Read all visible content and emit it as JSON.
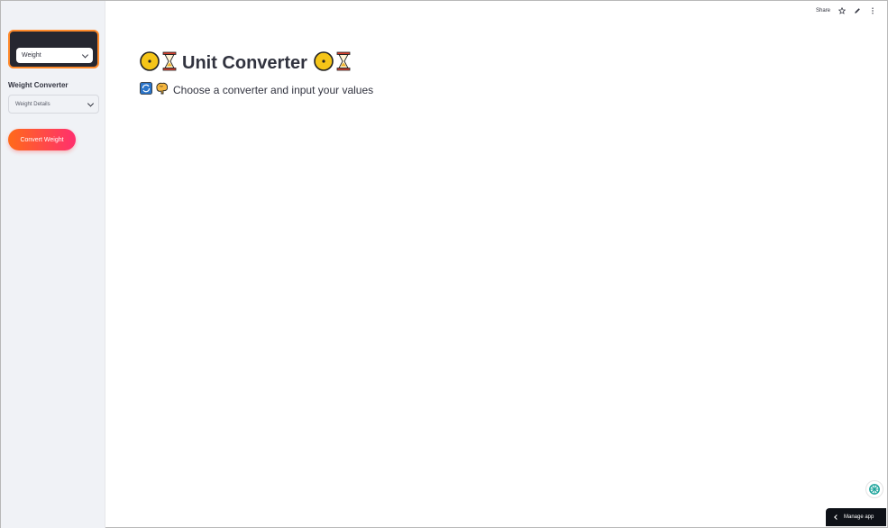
{
  "sidebar": {
    "converter_select": {
      "value": "Weight"
    },
    "section_label": "Weight Converter",
    "details_select": {
      "value": "Weight Details"
    },
    "convert_button": "Convert Weight"
  },
  "toolbar": {
    "share_label": "Share",
    "icons": [
      "star-icon",
      "pencil-icon",
      "more-vertical-icon"
    ]
  },
  "main": {
    "title": "Unit Converter",
    "subtitle": "Choose a converter and input your values",
    "title_icons": [
      "yellow-disc-icon",
      "hourglass-icon"
    ],
    "subtitle_icons": [
      "refresh-icon",
      "brain-icon"
    ]
  },
  "footer": {
    "manage_label": "Manage app"
  },
  "colors": {
    "accent_orange": "#ff6a1a",
    "accent_pink": "#ff2f6e",
    "sidebar_bg": "#f0f2f6",
    "card_bg": "#262730"
  }
}
